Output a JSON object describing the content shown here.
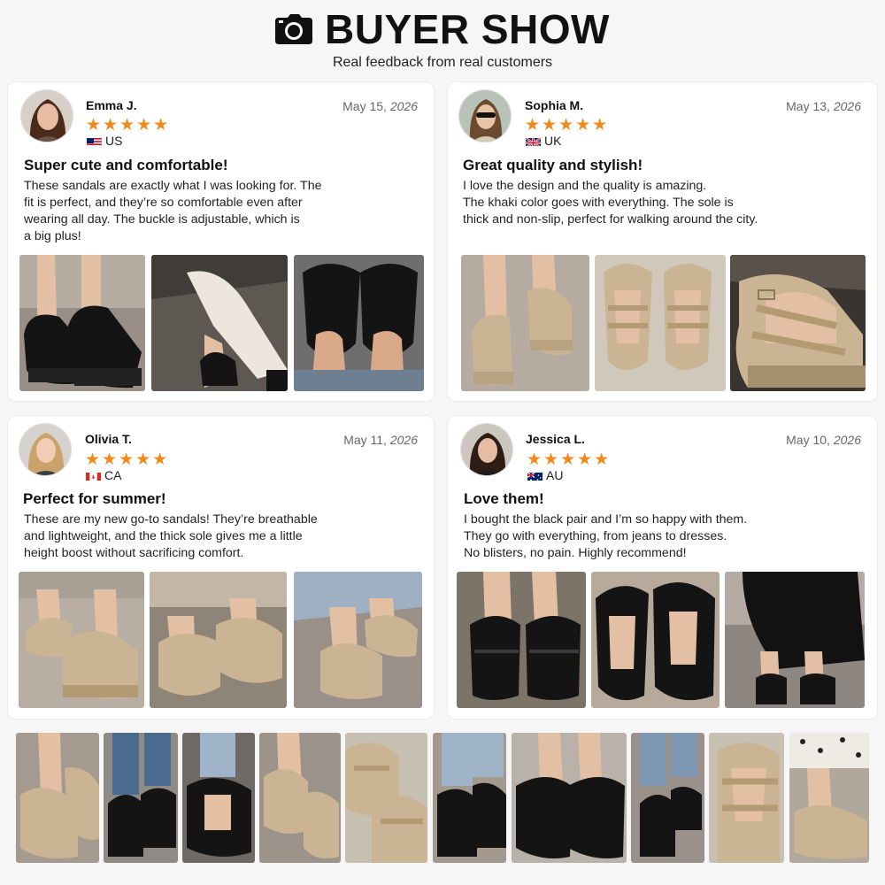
{
  "header": {
    "title": "BUYER SHOW",
    "subtitle": "Real feedback from real customers",
    "icon": "camera-icon"
  },
  "colors": {
    "star": "#f08a1c",
    "black_patent": "#141414",
    "khaki_patent": "#cbb494"
  },
  "reviews": [
    {
      "name": "Emma J.",
      "date_prefix": "May 15,",
      "date_year": "2026",
      "stars": "★★★★★",
      "rating": 5,
      "country": "US",
      "title": "Super cute and comfortable!",
      "body_lines": [
        "These sandals are exactly what I was looking for. The",
        "fit is perfect, and they’re so comfortable even after",
        "wearing all day. The buckle is adjustable, which is",
        "a big plus!"
      ]
    },
    {
      "name": "Sophia M.",
      "date_prefix": "May 13,",
      "date_year": "2026",
      "stars": "★★★★★",
      "rating": 5,
      "country": "UK",
      "title": "Great quality and stylish!",
      "body_lines": [
        "I love the design and the quality is amazing.",
        "The khaki color goes with everything. The sole is",
        "thick and non-slip, perfect for walking around the city."
      ]
    },
    {
      "name": "Olivia T.",
      "date_prefix": "May 11,",
      "date_year": "2026",
      "stars": "★★★★★",
      "rating": 5,
      "country": "CA",
      "title": "Perfect for summer!",
      "body_lines": [
        "These are my new go-to sandals! They’re breathable",
        "and lightweight, and the thick sole gives me a little",
        "height boost without sacrificing comfort."
      ]
    },
    {
      "name": "Jessica L.",
      "date_prefix": "May 10,",
      "date_year": "2026",
      "stars": "★★★★★",
      "rating": 5,
      "country": "AU",
      "title": "Love them!",
      "body_lines": [
        "I bought the black pair and I’m so happy with them.",
        "They go with everything, from jeans to dresses.",
        "No blisters, no pain. Highly recommend!"
      ]
    }
  ]
}
